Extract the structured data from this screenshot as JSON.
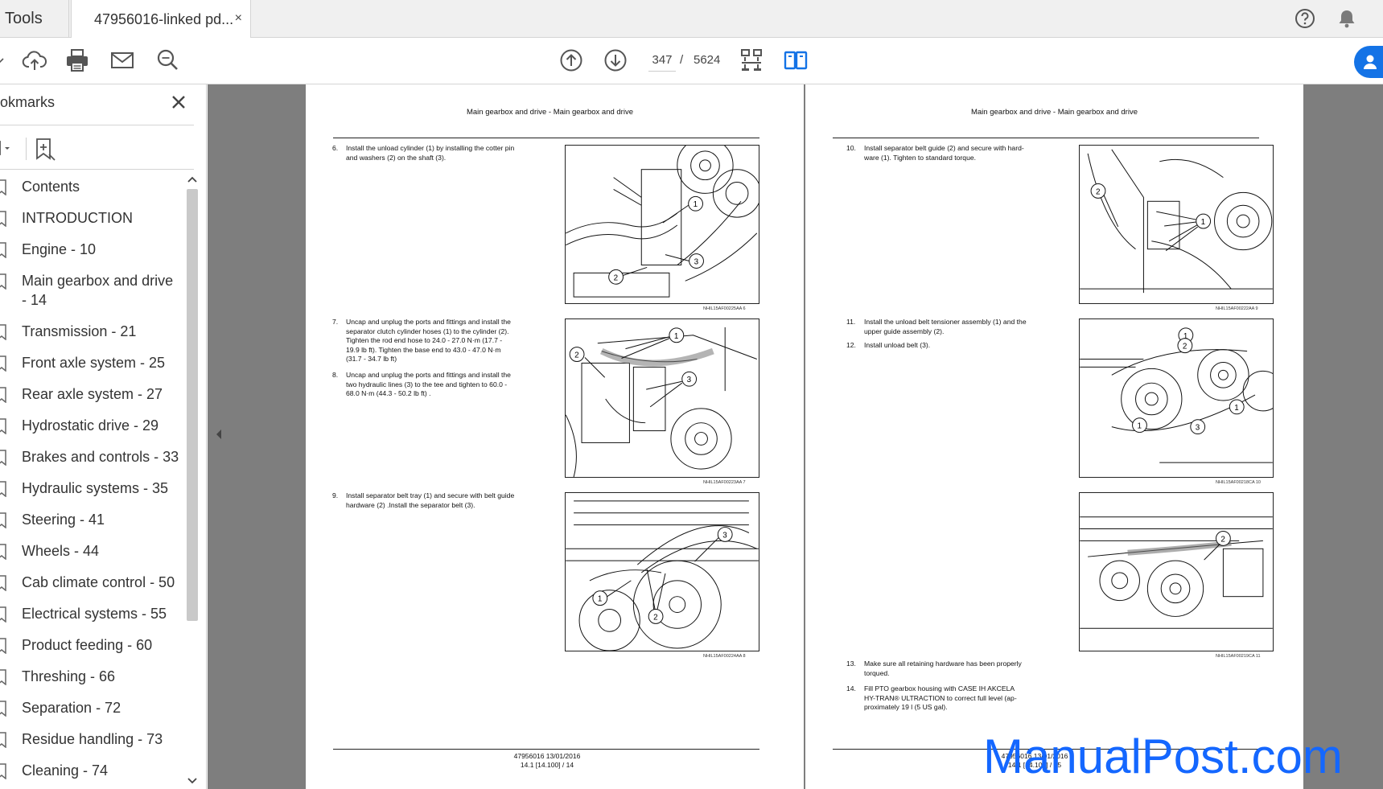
{
  "tabs": {
    "tools_label": "Tools",
    "doc_label": "47956016-linked pd...",
    "close_glyph": "×"
  },
  "toolbar": {
    "current_page": "347",
    "page_separator": "/",
    "total_pages": "5624"
  },
  "sidebar": {
    "title": "okmarks",
    "close_glyph": "✕",
    "items": [
      {
        "label": "Contents"
      },
      {
        "label": "INTRODUCTION"
      },
      {
        "label": "Engine - 10"
      },
      {
        "label": "Main gearbox and drive - 14"
      },
      {
        "label": "Transmission - 21"
      },
      {
        "label": "Front axle system - 25"
      },
      {
        "label": "Rear axle system - 27"
      },
      {
        "label": "Hydrostatic drive - 29"
      },
      {
        "label": "Brakes and controls - 33"
      },
      {
        "label": "Hydraulic systems - 35"
      },
      {
        "label": "Steering - 41"
      },
      {
        "label": "Wheels - 44"
      },
      {
        "label": "Cab climate control - 50"
      },
      {
        "label": "Electrical systems - 55"
      },
      {
        "label": "Product feeding - 60"
      },
      {
        "label": "Threshing - 66"
      },
      {
        "label": "Separation - 72"
      },
      {
        "label": "Residue handling - 73"
      },
      {
        "label": "Cleaning - 74"
      }
    ]
  },
  "document": {
    "left_page": {
      "header": "Main gearbox and drive - Main gearbox and drive",
      "steps": [
        {
          "num": "6.",
          "lines": [
            "Install the unload cylinder (1) by installing the cotter pin",
            "and washers (2) on the shaft (3)."
          ]
        },
        {
          "num": "7.",
          "lines": [
            "Uncap and unplug the ports and fittings and install the",
            "separator clutch cylinder hoses (1) to the cylinder (2).",
            "Tighten the rod end hose to 24.0 - 27.0 N·m (17.7 -",
            "19.9 lb ft).  Tighten the base end to 43.0 - 47.0 N·m",
            "(31.7 - 34.7 lb ft)"
          ]
        },
        {
          "num": "8.",
          "lines": [
            "Uncap and unplug the ports and fittings and install the",
            "two hydraulic lines (3) to the tee and tighten to 60.0 -",
            "68.0 N·m (44.3 - 50.2 lb ft) ."
          ]
        },
        {
          "num": "9.",
          "lines": [
            "Install separator belt tray (1) and secure with belt guide",
            "hardware (2) .Install the separator belt (3)."
          ]
        }
      ],
      "figure_codes": [
        "NHIL15AF00225AA    6",
        "NHIL15AF00223AA    7",
        "NHIL15AF00224AA    8"
      ],
      "footer_line1": "47956016 13/01/2016",
      "footer_line2": "14.1 [14.100] / 14"
    },
    "right_page": {
      "header": "Main gearbox and drive - Main gearbox and drive",
      "steps": [
        {
          "num": "10.",
          "lines": [
            "Install separator belt guide (2) and secure with hard-",
            "ware (1). Tighten to standard torque."
          ]
        },
        {
          "num": "11.",
          "lines": [
            "Install the unload belt tensioner assembly (1) and the",
            "upper guide assembly (2)."
          ]
        },
        {
          "num": "12.",
          "lines": [
            "Install unload belt (3)."
          ]
        },
        {
          "num": "13.",
          "lines": [
            "Make sure all retaining hardware has been properly",
            "torqued."
          ]
        },
        {
          "num": "14.",
          "lines": [
            "Fill PTO gearbox housing with CASE IH AKCELA",
            "HY-TRAN® ULTRACTION to correct full level (ap-",
            "proximately 19 l (5 US gal)."
          ]
        }
      ],
      "figure_codes": [
        "NHIL15AF00222AA    9",
        "NHIL15AF00218CA    10",
        "NHIL15AF00219CA    11"
      ],
      "footer_line1": "47956016 13/01/2016",
      "footer_line2": "14.1 [14.100] / 15"
    }
  },
  "watermark": "ManualPost.com"
}
